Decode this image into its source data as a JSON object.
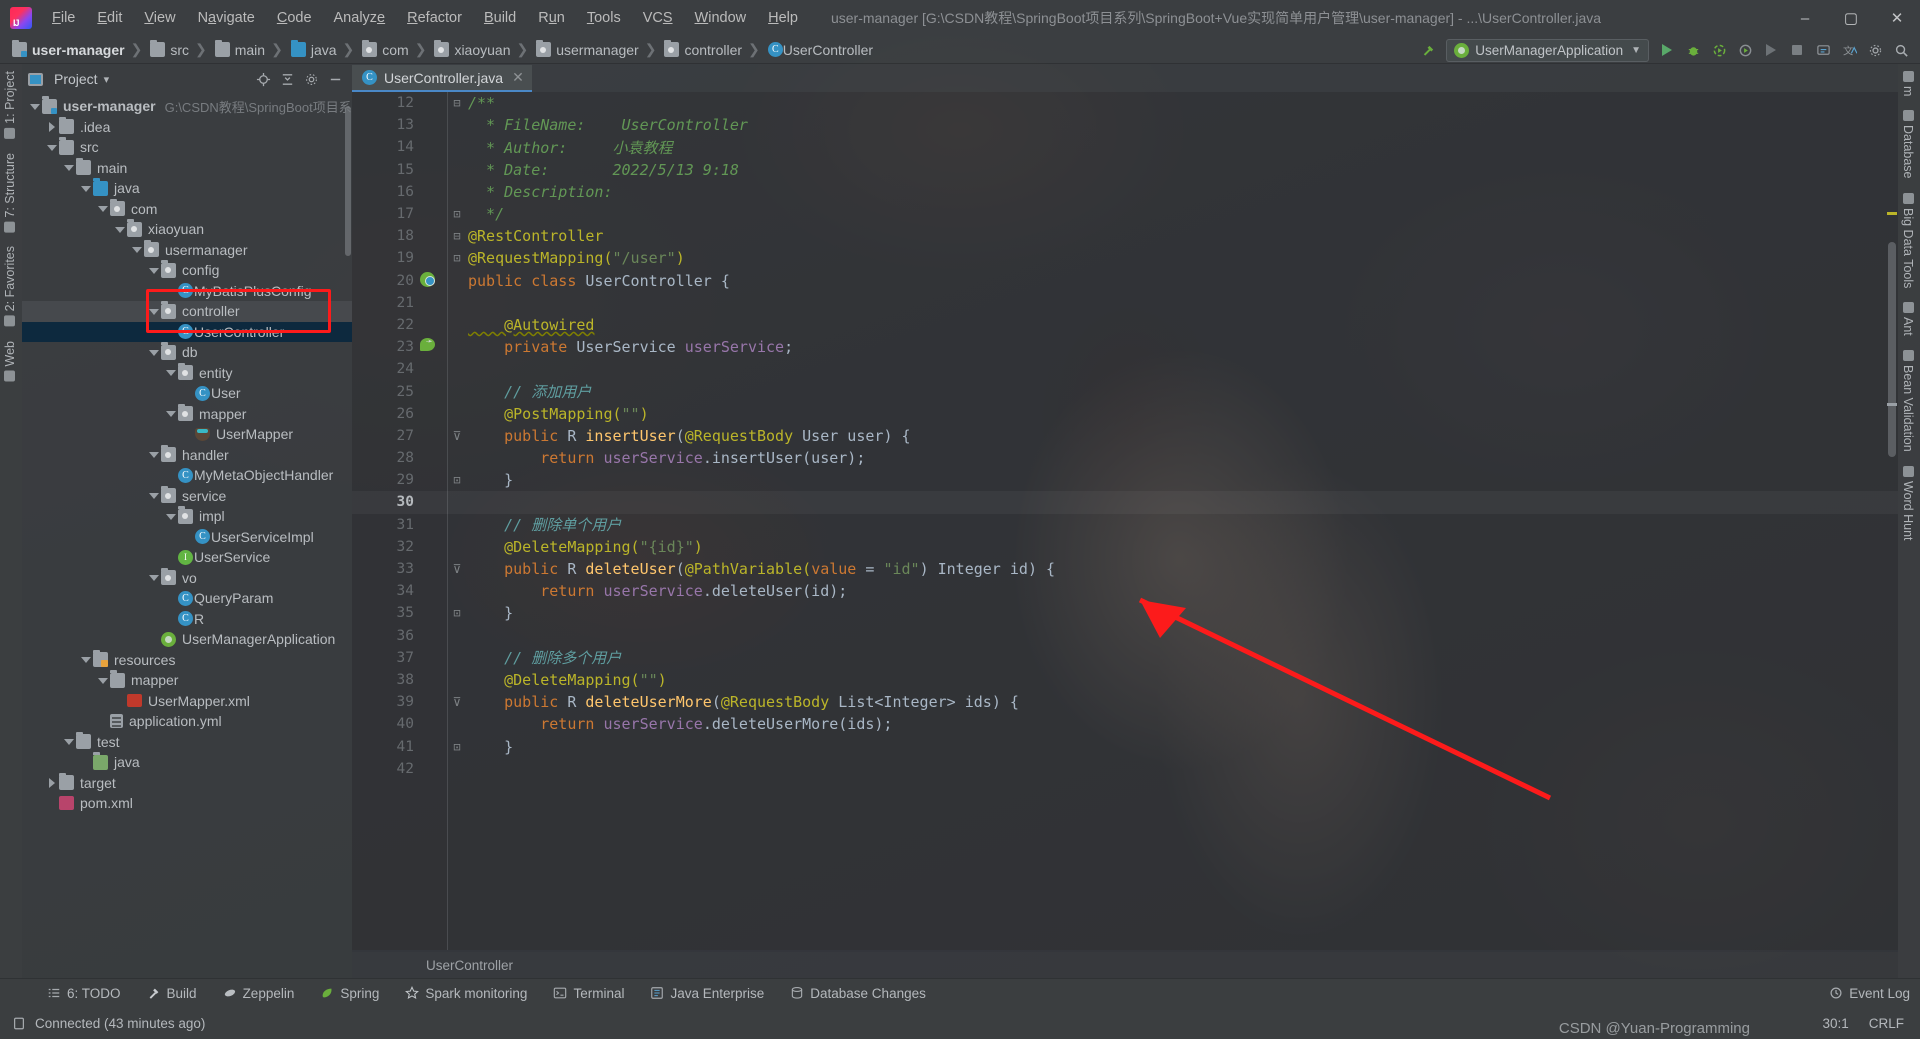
{
  "window": {
    "title": "user-manager [G:\\CSDN教程\\SpringBoot项目系列\\SpringBoot+Vue实现简单用户管理\\user-manager] - ...\\UserController.java",
    "minimize_label": "–",
    "maximize_label": "▢",
    "close_label": "✕"
  },
  "menubar": {
    "logo_name": "intellij-idea-logo",
    "items": [
      {
        "label": "File"
      },
      {
        "label": "Edit"
      },
      {
        "label": "View"
      },
      {
        "label": "Navigate"
      },
      {
        "label": "Code"
      },
      {
        "label": "Analyze"
      },
      {
        "label": "Refactor"
      },
      {
        "label": "Build"
      },
      {
        "label": "Run"
      },
      {
        "label": "Tools"
      },
      {
        "label": "VCS"
      },
      {
        "label": "Window"
      },
      {
        "label": "Help"
      }
    ]
  },
  "breadcrumbs": {
    "sep": "❯",
    "items": [
      {
        "label": "user-manager",
        "icon": "module-folder-icon"
      },
      {
        "label": "src",
        "icon": "folder-icon"
      },
      {
        "label": "main",
        "icon": "folder-icon"
      },
      {
        "label": "java",
        "icon": "source-folder-icon"
      },
      {
        "label": "com",
        "icon": "package-icon"
      },
      {
        "label": "xiaoyuan",
        "icon": "package-icon"
      },
      {
        "label": "usermanager",
        "icon": "package-icon"
      },
      {
        "label": "controller",
        "icon": "package-icon"
      },
      {
        "label": "UserController",
        "icon": "class-icon"
      }
    ]
  },
  "toolbar": {
    "run_config": "UserManagerApplication",
    "run_config_icon": "spring-boot-icon",
    "build_icon": "build-hammer-icon",
    "buttons": [
      {
        "name": "run-button",
        "glyph": "▶"
      },
      {
        "name": "debug-button",
        "glyph": "🐞"
      },
      {
        "name": "run-with-coverage-button",
        "glyph": "▶"
      },
      {
        "name": "profiler-button",
        "glyph": "◎"
      },
      {
        "name": "rerun-button",
        "glyph": "▶"
      },
      {
        "name": "stop-button",
        "glyph": "■"
      },
      {
        "name": "update-project-button",
        "glyph": "⟳"
      },
      {
        "name": "translate-button",
        "glyph": "文"
      },
      {
        "name": "settings-button",
        "glyph": "⚙"
      },
      {
        "name": "search-everywhere-button",
        "glyph": "🔍"
      }
    ]
  },
  "project_panel": {
    "title": "Project",
    "chevron": "▾",
    "header_icons": [
      {
        "name": "select-opened-file-icon",
        "glyph": "⊕"
      },
      {
        "name": "collapse-all-icon",
        "glyph": "⤓"
      },
      {
        "name": "settings-gear-icon",
        "glyph": "⚙"
      },
      {
        "name": "hide-panel-icon",
        "glyph": "—"
      }
    ],
    "tree": [
      {
        "label": "user-manager",
        "path": "G:\\CSDN教程\\SpringBoot项目系列",
        "indent": 0,
        "arrow": "down",
        "icon": "module-folder-icon",
        "bold": true
      },
      {
        "label": ".idea",
        "indent": 1,
        "arrow": "right",
        "icon": "folder-icon"
      },
      {
        "label": "src",
        "indent": 1,
        "arrow": "down",
        "icon": "folder-icon"
      },
      {
        "label": "main",
        "indent": 2,
        "arrow": "down",
        "icon": "folder-icon"
      },
      {
        "label": "java",
        "indent": 3,
        "arrow": "down",
        "icon": "source-folder-icon"
      },
      {
        "label": "com",
        "indent": 4,
        "arrow": "down",
        "icon": "package-icon"
      },
      {
        "label": "xiaoyuan",
        "indent": 5,
        "arrow": "down",
        "icon": "package-icon"
      },
      {
        "label": "usermanager",
        "indent": 6,
        "arrow": "down",
        "icon": "package-icon"
      },
      {
        "label": "config",
        "indent": 7,
        "arrow": "down",
        "icon": "package-icon"
      },
      {
        "label": "MyBatisPlusConfig",
        "indent": 8,
        "arrow": "none",
        "icon": "class-icon"
      },
      {
        "label": "controller",
        "indent": 7,
        "arrow": "down",
        "icon": "package-icon",
        "row_highlight": true
      },
      {
        "label": "UserController",
        "indent": 8,
        "arrow": "none",
        "icon": "class-icon",
        "selected": true
      },
      {
        "label": "db",
        "indent": 7,
        "arrow": "down",
        "icon": "package-icon"
      },
      {
        "label": "entity",
        "indent": 8,
        "arrow": "down",
        "icon": "package-icon"
      },
      {
        "label": "User",
        "indent": 9,
        "arrow": "none",
        "icon": "class-icon"
      },
      {
        "label": "mapper",
        "indent": 8,
        "arrow": "down",
        "icon": "package-icon"
      },
      {
        "label": "UserMapper",
        "indent": 9,
        "arrow": "none",
        "icon": "mapper-icon"
      },
      {
        "label": "handler",
        "indent": 7,
        "arrow": "down",
        "icon": "package-icon"
      },
      {
        "label": "MyMetaObjectHandler",
        "indent": 8,
        "arrow": "none",
        "icon": "class-icon"
      },
      {
        "label": "service",
        "indent": 7,
        "arrow": "down",
        "icon": "package-icon"
      },
      {
        "label": "impl",
        "indent": 8,
        "arrow": "down",
        "icon": "package-icon"
      },
      {
        "label": "UserServiceImpl",
        "indent": 9,
        "arrow": "none",
        "icon": "class-icon"
      },
      {
        "label": "UserService",
        "indent": 8,
        "arrow": "none",
        "icon": "interface-icon"
      },
      {
        "label": "vo",
        "indent": 7,
        "arrow": "down",
        "icon": "package-icon"
      },
      {
        "label": "QueryParam",
        "indent": 8,
        "arrow": "none",
        "icon": "class-icon"
      },
      {
        "label": "R",
        "indent": 8,
        "arrow": "none",
        "icon": "class-icon"
      },
      {
        "label": "UserManagerApplication",
        "indent": 7,
        "arrow": "none",
        "icon": "spring-boot-icon"
      },
      {
        "label": "resources",
        "indent": 3,
        "arrow": "down",
        "icon": "resources-folder-icon"
      },
      {
        "label": "mapper",
        "indent": 4,
        "arrow": "down",
        "icon": "folder-icon"
      },
      {
        "label": "UserMapper.xml",
        "indent": 5,
        "arrow": "none",
        "icon": "xml-icon"
      },
      {
        "label": "application.yml",
        "indent": 4,
        "arrow": "none",
        "icon": "yml-icon"
      },
      {
        "label": "test",
        "indent": 2,
        "arrow": "down",
        "icon": "folder-icon"
      },
      {
        "label": "java",
        "indent": 3,
        "arrow": "none",
        "icon": "test-source-folder-icon"
      },
      {
        "label": "target",
        "indent": 1,
        "arrow": "right",
        "icon": "folder-icon"
      },
      {
        "label": "pom.xml",
        "indent": 1,
        "arrow": "none",
        "icon": "maven-icon"
      }
    ]
  },
  "editor": {
    "tab": {
      "label": "UserController.java",
      "icon": "class-icon",
      "close_glyph": "✕"
    },
    "status_breadcrumb": "UserController",
    "lines": [
      {
        "n": 12,
        "fold": "⊟",
        "caret": false,
        "gutter": "",
        "tokens": [
          {
            "t": "/**",
            "c": "cmt"
          }
        ]
      },
      {
        "n": 13,
        "fold": "",
        "caret": false,
        "gutter": "",
        "tokens": [
          {
            "t": "  * FileName:    UserController",
            "c": "cmt"
          }
        ]
      },
      {
        "n": 14,
        "fold": "",
        "caret": false,
        "gutter": "",
        "tokens": [
          {
            "t": "  * Author:     小袁教程",
            "c": "cmt"
          }
        ]
      },
      {
        "n": 15,
        "fold": "",
        "caret": false,
        "gutter": "",
        "tokens": [
          {
            "t": "  * Date:       2022/5/13 9:18",
            "c": "cmt"
          }
        ]
      },
      {
        "n": 16,
        "fold": "",
        "caret": false,
        "gutter": "",
        "tokens": [
          {
            "t": "  * Description:",
            "c": "cmt"
          }
        ]
      },
      {
        "n": 17,
        "fold": "⊡",
        "caret": false,
        "gutter": "",
        "tokens": [
          {
            "t": "  */",
            "c": "cmt"
          }
        ]
      },
      {
        "n": 18,
        "fold": "⊟",
        "caret": false,
        "gutter": "",
        "tokens": [
          {
            "t": "@RestController",
            "c": "ann"
          }
        ]
      },
      {
        "n": 19,
        "fold": "⊡",
        "caret": false,
        "gutter": "",
        "tokens": [
          {
            "t": "@RequestMapping(",
            "c": "ann"
          },
          {
            "t": "\"/user\"",
            "c": "str"
          },
          {
            "t": ")",
            "c": "ann"
          }
        ]
      },
      {
        "n": 20,
        "fold": "",
        "caret": false,
        "gutter": "bean",
        "tokens": [
          {
            "t": "public ",
            "c": "kw"
          },
          {
            "t": "class ",
            "c": "kw"
          },
          {
            "t": "UserController ",
            "c": "typ"
          },
          {
            "t": "{",
            "c": "pln"
          }
        ]
      },
      {
        "n": 21,
        "fold": "",
        "caret": false,
        "gutter": "",
        "tokens": []
      },
      {
        "n": 22,
        "fold": "",
        "caret": false,
        "gutter": "",
        "tokens": [
          {
            "t": "    @Autowired",
            "c": "ann wavy"
          }
        ]
      },
      {
        "n": 23,
        "fold": "",
        "caret": false,
        "gutter": "nav",
        "tokens": [
          {
            "t": "    private ",
            "c": "kw"
          },
          {
            "t": "UserService ",
            "c": "typ"
          },
          {
            "t": "userService",
            "c": "fld"
          },
          {
            "t": ";",
            "c": "pln"
          }
        ]
      },
      {
        "n": 24,
        "fold": "",
        "caret": false,
        "gutter": "",
        "tokens": []
      },
      {
        "n": 25,
        "fold": "",
        "caret": false,
        "gutter": "",
        "tokens": [
          {
            "t": "    // 添加用户",
            "c": "cmt2"
          }
        ]
      },
      {
        "n": 26,
        "fold": "",
        "caret": false,
        "gutter": "",
        "tokens": [
          {
            "t": "    @PostMapping(",
            "c": "ann"
          },
          {
            "t": "\"\"",
            "c": "str"
          },
          {
            "t": ")",
            "c": "ann"
          }
        ]
      },
      {
        "n": 27,
        "fold": "⊽",
        "caret": false,
        "gutter": "",
        "tokens": [
          {
            "t": "    public ",
            "c": "kw"
          },
          {
            "t": "R ",
            "c": "typ"
          },
          {
            "t": "insertUser",
            "c": "mth"
          },
          {
            "t": "(",
            "c": "pln"
          },
          {
            "t": "@RequestBody ",
            "c": "ann"
          },
          {
            "t": "User user",
            "c": "typ"
          },
          {
            "t": ") {",
            "c": "pln"
          }
        ]
      },
      {
        "n": 28,
        "fold": "",
        "caret": false,
        "gutter": "",
        "tokens": [
          {
            "t": "        return ",
            "c": "kw"
          },
          {
            "t": "userService",
            "c": "fld"
          },
          {
            "t": ".insertUser(user);",
            "c": "pln"
          }
        ]
      },
      {
        "n": 29,
        "fold": "⊡",
        "caret": false,
        "gutter": "",
        "tokens": [
          {
            "t": "    }",
            "c": "pln"
          }
        ]
      },
      {
        "n": 30,
        "fold": "",
        "caret": true,
        "gutter": "",
        "tokens": []
      },
      {
        "n": 31,
        "fold": "",
        "caret": false,
        "gutter": "",
        "tokens": [
          {
            "t": "    // 删除单个用户",
            "c": "cmt2"
          }
        ]
      },
      {
        "n": 32,
        "fold": "",
        "caret": false,
        "gutter": "",
        "tokens": [
          {
            "t": "    @DeleteMapping(",
            "c": "ann"
          },
          {
            "t": "\"{id}\"",
            "c": "str"
          },
          {
            "t": ")",
            "c": "ann"
          }
        ]
      },
      {
        "n": 33,
        "fold": "⊽",
        "caret": false,
        "gutter": "",
        "tokens": [
          {
            "t": "    public ",
            "c": "kw"
          },
          {
            "t": "R ",
            "c": "typ"
          },
          {
            "t": "deleteUser",
            "c": "mth"
          },
          {
            "t": "(",
            "c": "pln"
          },
          {
            "t": "@PathVariable(",
            "c": "ann"
          },
          {
            "t": "value ",
            "c": "kw"
          },
          {
            "t": "= ",
            "c": "pln"
          },
          {
            "t": "\"id\"",
            "c": "str"
          },
          {
            "t": ") ",
            "c": "pln"
          },
          {
            "t": "Integer id",
            "c": "typ"
          },
          {
            "t": ") {",
            "c": "pln"
          }
        ]
      },
      {
        "n": 34,
        "fold": "",
        "caret": false,
        "gutter": "",
        "tokens": [
          {
            "t": "        return ",
            "c": "kw"
          },
          {
            "t": "userService",
            "c": "fld"
          },
          {
            "t": ".deleteUser(id);",
            "c": "pln"
          }
        ]
      },
      {
        "n": 35,
        "fold": "⊡",
        "caret": false,
        "gutter": "",
        "tokens": [
          {
            "t": "    }",
            "c": "pln"
          }
        ]
      },
      {
        "n": 36,
        "fold": "",
        "caret": false,
        "gutter": "",
        "tokens": []
      },
      {
        "n": 37,
        "fold": "",
        "caret": false,
        "gutter": "",
        "tokens": [
          {
            "t": "    // 删除多个用户",
            "c": "cmt2"
          }
        ]
      },
      {
        "n": 38,
        "fold": "",
        "caret": false,
        "gutter": "",
        "tokens": [
          {
            "t": "    @DeleteMapping(",
            "c": "ann"
          },
          {
            "t": "\"\"",
            "c": "str"
          },
          {
            "t": ")",
            "c": "ann"
          }
        ]
      },
      {
        "n": 39,
        "fold": "⊽",
        "caret": false,
        "gutter": "",
        "tokens": [
          {
            "t": "    public ",
            "c": "kw"
          },
          {
            "t": "R ",
            "c": "typ"
          },
          {
            "t": "deleteUserMore",
            "c": "mth"
          },
          {
            "t": "(",
            "c": "pln"
          },
          {
            "t": "@RequestBody ",
            "c": "ann"
          },
          {
            "t": "List<Integer> ids",
            "c": "typ"
          },
          {
            "t": ") {",
            "c": "pln"
          }
        ]
      },
      {
        "n": 40,
        "fold": "",
        "caret": false,
        "gutter": "",
        "tokens": [
          {
            "t": "        return ",
            "c": "kw"
          },
          {
            "t": "userService",
            "c": "fld"
          },
          {
            "t": ".deleteUserMore(ids);",
            "c": "pln"
          }
        ]
      },
      {
        "n": 41,
        "fold": "⊡",
        "caret": false,
        "gutter": "",
        "tokens": [
          {
            "t": "    }",
            "c": "pln"
          }
        ]
      },
      {
        "n": 42,
        "fold": "",
        "caret": false,
        "gutter": "",
        "tokens": []
      }
    ]
  },
  "left_rail": [
    {
      "label": "1: Project",
      "icon": "project-icon"
    },
    {
      "label": "7: Structure",
      "icon": "structure-icon"
    },
    {
      "label": "2: Favorites",
      "icon": "favorites-icon"
    },
    {
      "label": "Web",
      "icon": "web-icon"
    }
  ],
  "right_rail": [
    {
      "label": "m",
      "icon": "maven-icon"
    },
    {
      "label": "Database",
      "icon": "database-icon"
    },
    {
      "label": "Big Data Tools",
      "icon": "bigdata-icon"
    },
    {
      "label": "Ant",
      "icon": "ant-icon"
    },
    {
      "label": "Bean Validation",
      "icon": "bean-validation-icon"
    },
    {
      "label": "Word Hunt",
      "icon": "word-hunt-icon"
    }
  ],
  "bottom_bar": {
    "items": [
      {
        "label": "6: TODO",
        "icon": "todo-icon"
      },
      {
        "label": "Build",
        "icon": "build-hammer-icon"
      },
      {
        "label": "Zeppelin",
        "icon": "zeppelin-icon"
      },
      {
        "label": "Spring",
        "icon": "spring-leaf-icon"
      },
      {
        "label": "Spark monitoring",
        "icon": "spark-star-icon"
      },
      {
        "label": "Terminal",
        "icon": "terminal-icon"
      },
      {
        "label": "Java Enterprise",
        "icon": "java-enterprise-icon"
      },
      {
        "label": "Database Changes",
        "icon": "database-changes-icon"
      }
    ],
    "event_log": {
      "label": "Event Log",
      "icon": "event-log-icon"
    }
  },
  "statusbar": {
    "connected": "Connected (43 minutes ago)",
    "connected_icon": "database-connection-icon",
    "caret_position": "30:1",
    "line_separator": "CRLF",
    "watermark": "CSDN @Yuan-Programming"
  },
  "colors": {
    "accent_blue": "#3592c4",
    "selection_blue": "#0d293e",
    "annotation_red": "#fc1b1b",
    "green_run": "#59a869",
    "keyword_orange": "#cc7832",
    "annotation_yellow": "#bbb529",
    "string_green": "#6a8759",
    "comment_green": "#629755",
    "field_purple": "#9876aa",
    "method_yellow": "#ffc66d",
    "text_grey": "#a9b7c6"
  }
}
